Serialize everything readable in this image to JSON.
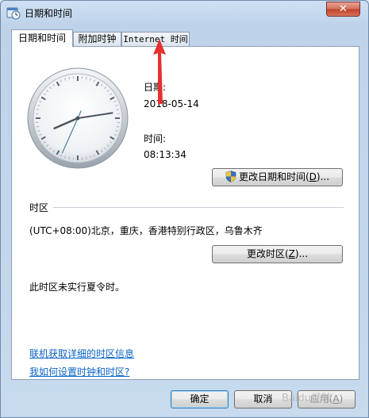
{
  "window": {
    "title": "日期和时间",
    "close_glyph": "✕"
  },
  "tabs": [
    {
      "label": "日期和时间",
      "active": true
    },
    {
      "label": "附加时钟",
      "active": false
    },
    {
      "label": "Internet 时间",
      "active": false
    }
  ],
  "datetime": {
    "date_label": "日期:",
    "date_value": "2018-05-14",
    "time_label": "时间:",
    "time_value": "08:13:34",
    "change_button": "更改日期和时间(",
    "change_button_key": "D",
    "change_button_suffix": ")..."
  },
  "timezone": {
    "section_label": "时区",
    "value": "(UTC+08:00)北京，重庆，香港特别行政区，乌鲁木齐",
    "change_button": "更改时区(",
    "change_button_key": "Z",
    "change_button_suffix": ")...",
    "dst_note": "此时区未实行夏令时。"
  },
  "links": {
    "online_tz_info": "联机获取详细的时区信息",
    "how_to_set": "我如何设置时钟和时区?"
  },
  "footer": {
    "ok": "确定",
    "cancel": "取消",
    "apply": "应用",
    "apply_key": "A"
  },
  "clock": {
    "hours": 8,
    "minutes": 13,
    "seconds": 34
  },
  "colors": {
    "accent_red": "#e53030",
    "link": "#0a63c8"
  },
  "watermark": "Baidu经验"
}
